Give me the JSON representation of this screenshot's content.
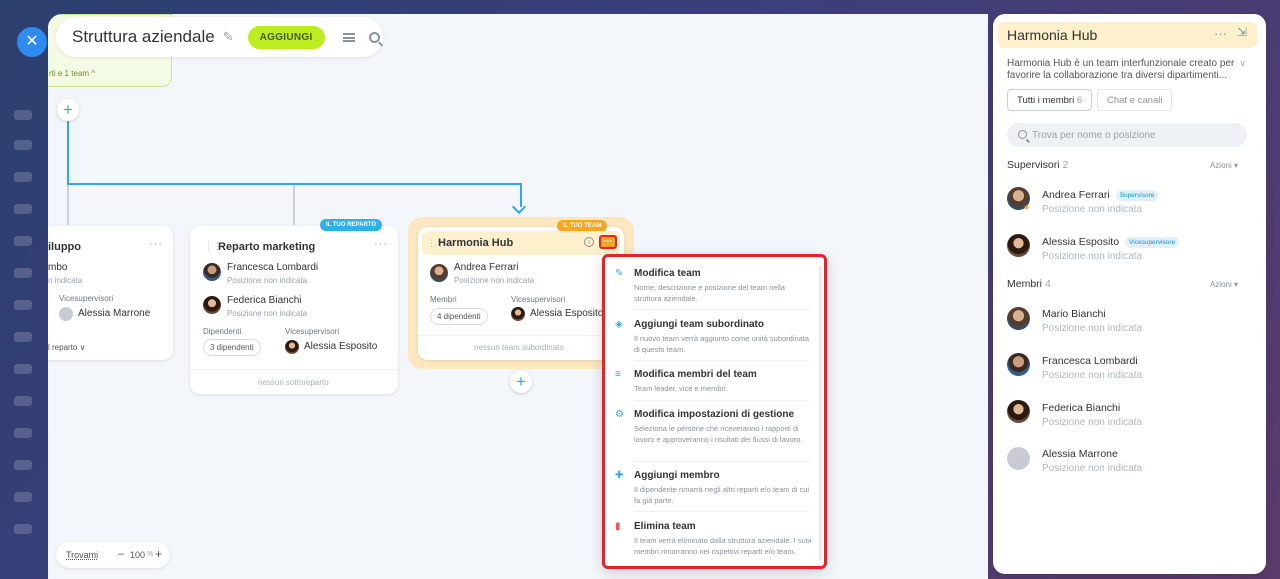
{
  "toolbar": {
    "title": "Struttura aziendale",
    "add_label": "AGGIUNGI"
  },
  "root": {
    "summary": "rti e 1 team ^"
  },
  "cards": {
    "sviluppo": {
      "title": "iluppo",
      "person_name": "mbo",
      "person_pos": "n indicata",
      "deputy_label": "Vicesupervisori",
      "deputy_name": "Alessia Marrone",
      "footer": "l reparto ∨"
    },
    "marketing": {
      "badge": "IL TUO REPARTO",
      "title": "Reparto marketing",
      "people": [
        {
          "name": "Francesca Lombardi",
          "pos": "Posizione non indicata"
        },
        {
          "name": "Federica Bianchi",
          "pos": "Posizione non indicata"
        }
      ],
      "employees_label": "Dipendenti",
      "employees_count": "3 dipendenti",
      "deputy_label": "Vicesupervisori",
      "deputy_name": "Alessia Esposito",
      "footer": "nessun sottoreparto"
    },
    "harmonia": {
      "badge": "IL TUO TEAM",
      "title": "Harmonia Hub",
      "person_name": "Andrea Ferrari",
      "person_pos": "Posizione non indicata",
      "members_label": "Membri",
      "members_count": "4 dipendenti",
      "deputy_label": "Vicesupervisori",
      "deputy_name": "Alessia Esposito",
      "footer": "nessun team subordinato"
    }
  },
  "menu": {
    "items": [
      {
        "icon": "edit-icon",
        "title": "Modifica team",
        "desc": "Nome, descrizione e posizione del team nella struttura aziendale."
      },
      {
        "icon": "subteam-icon",
        "title": "Aggiungi team subordinato",
        "desc": "Il nuovo team verrà aggiunto come unità subordinata di questo team."
      },
      {
        "icon": "members-edit-icon",
        "title": "Modifica membri del team",
        "desc": "Team leader, vice e membri."
      },
      {
        "icon": "gear-icon",
        "title": "Modifica impostazioni di gestione",
        "desc": "Seleziona le persone che riceveranno i rapporti di lavoro e approveranno i risultati dei flussi di lavoro."
      },
      {
        "icon": "add-member-icon",
        "title": "Aggiungi membro",
        "desc": "Il dipendente rimarrà negli altri reparti e/o team di cui fa già parte."
      },
      {
        "icon": "trash-icon",
        "title": "Elimina team",
        "desc": "Il team verrà eliminato dalla struttura aziendale. I suoi membri rimarranno nei rispettivi reparti e/o team."
      }
    ]
  },
  "zoom": {
    "find_label": "Trovami",
    "value": "100",
    "unit": "%"
  },
  "panel": {
    "title": "Harmonia Hub",
    "description": "Harmonia Hub è un team interfunzionale creato per favorire la collaborazione tra diversi dipartimenti...",
    "tabs": {
      "members": "Tutti i membri",
      "members_count": "6",
      "chats": "Chat e canali"
    },
    "search_placeholder": "Trova per nome o posizione",
    "supervisors": {
      "title": "Supervisori",
      "count": "2",
      "action": "Azioni",
      "people": [
        {
          "name": "Andrea Ferrari",
          "role": "Supervisore",
          "pos": "Posizione non indicata"
        },
        {
          "name": "Alessia Esposito",
          "role": "Vicesupervisore",
          "pos": "Posizione non indicata"
        }
      ]
    },
    "members": {
      "title": "Membri",
      "count": "4",
      "action": "Azioni",
      "people": [
        {
          "name": "Mario Bianchi",
          "pos": "Posizione non indicata"
        },
        {
          "name": "Francesca Lombardi",
          "pos": "Posizione non indicata"
        },
        {
          "name": "Federica Bianchi",
          "pos": "Posizione non indicata"
        },
        {
          "name": "Alessia Marrone",
          "pos": "Posizione non indicata"
        }
      ]
    }
  }
}
